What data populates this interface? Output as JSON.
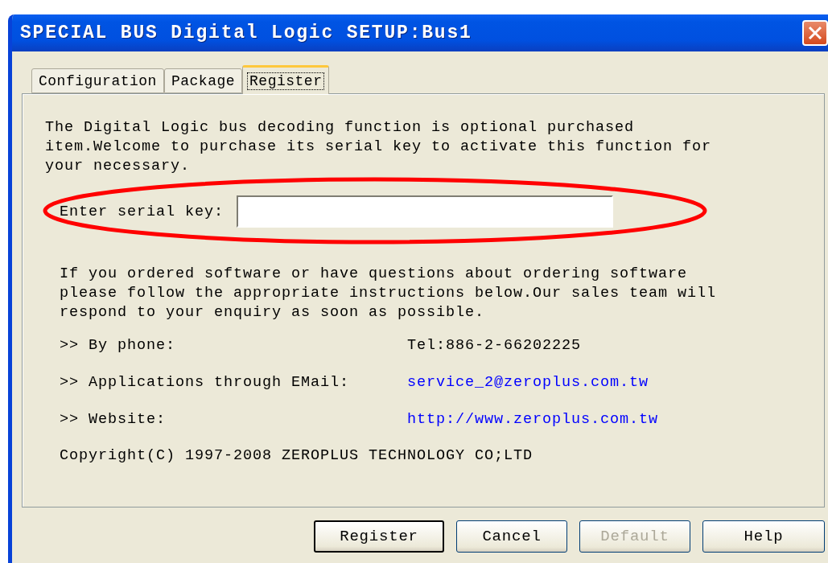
{
  "window": {
    "title": "SPECIAL BUS Digital Logic SETUP:Bus1"
  },
  "tabs": [
    {
      "label": "Configuration",
      "selected": false
    },
    {
      "label": "Package",
      "selected": false
    },
    {
      "label": "Register",
      "selected": true
    }
  ],
  "intro_lines": [
    "The Digital Logic bus decoding function is optional purchased",
    "item.Welcome to purchase its serial key to activate this function for",
    "your necessary."
  ],
  "serial_key": {
    "label": "Enter serial key:"
  },
  "info_lines": [
    "If you ordered software or have questions about ordering software",
    "please follow the appropriate instructions below.Our sales team will",
    "respond to your enquiry as soon as possible."
  ],
  "contacts": [
    {
      "label": ">> By phone:",
      "value": "Tel:886-2-66202225",
      "kind": "text"
    },
    {
      "label": ">> Applications through EMail:",
      "value": "service_2@zeroplus.com.tw",
      "kind": "link"
    },
    {
      "label": ">> Website:",
      "value": "http://www.zeroplus.com.tw",
      "kind": "link"
    }
  ],
  "copyright": "Copyright(C) 1997-2008 ZEROPLUS TECHNOLOGY CO;LTD",
  "buttons": [
    {
      "label": "Register",
      "default": true,
      "disabled": false
    },
    {
      "label": "Cancel",
      "default": false,
      "disabled": false
    },
    {
      "label": "Default",
      "default": false,
      "disabled": true
    },
    {
      "label": "Help",
      "default": false,
      "disabled": false
    }
  ]
}
